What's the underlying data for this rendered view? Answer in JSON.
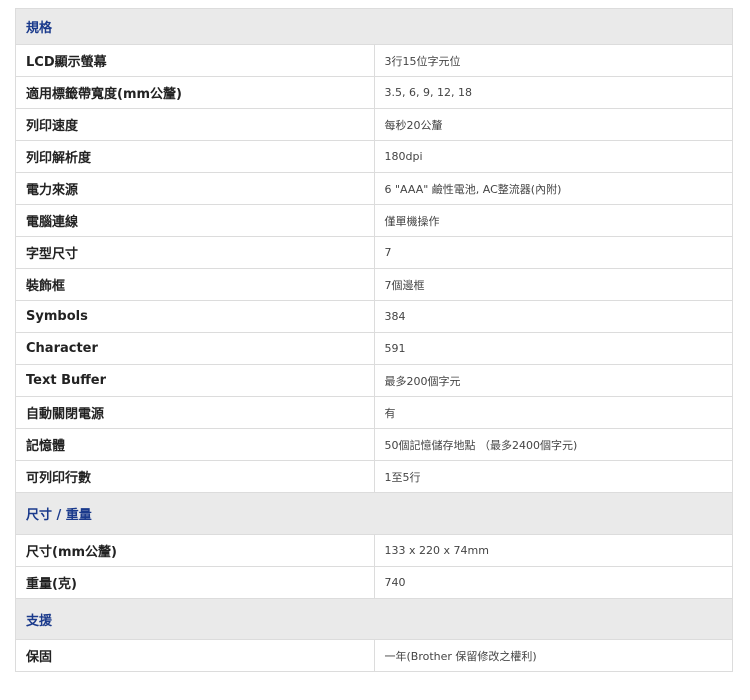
{
  "sections": [
    {
      "title": "規格",
      "rows": [
        {
          "label": "LCD顯示螢幕",
          "value": "3行15位字元位"
        },
        {
          "label": "適用標籤帶寬度(mm公釐)",
          "value": "3.5, 6, 9, 12, 18"
        },
        {
          "label": "列印速度",
          "value": "每秒20公釐"
        },
        {
          "label": "列印解析度",
          "value": "180dpi"
        },
        {
          "label": "電力來源",
          "value": "6 \"AAA\" 鹼性電池, AC整流器(內附)"
        },
        {
          "label": "電腦連線",
          "value": "僅單機操作"
        },
        {
          "label": "字型尺寸",
          "value": "7"
        },
        {
          "label": "裝飾框",
          "value": "7個邊框"
        },
        {
          "label": "Symbols",
          "value": "384"
        },
        {
          "label": "Character",
          "value": "591"
        },
        {
          "label": "Text Buffer",
          "value": "最多200個字元"
        },
        {
          "label": "自動關閉電源",
          "value": "有"
        },
        {
          "label": "記憶體",
          "value": "50個記憶儲存地點 （最多2400個字元)"
        },
        {
          "label": "可列印行數",
          "value": "1至5行"
        }
      ]
    },
    {
      "title": "尺寸 / 重量",
      "rows": [
        {
          "label": "尺寸(mm公釐)",
          "value": "133 x 220 x 74mm"
        },
        {
          "label": "重量(克)",
          "value": "740"
        }
      ]
    },
    {
      "title": "支援",
      "rows": [
        {
          "label": "保固",
          "value": "一年(Brother 保留修改之權利)"
        }
      ]
    }
  ]
}
